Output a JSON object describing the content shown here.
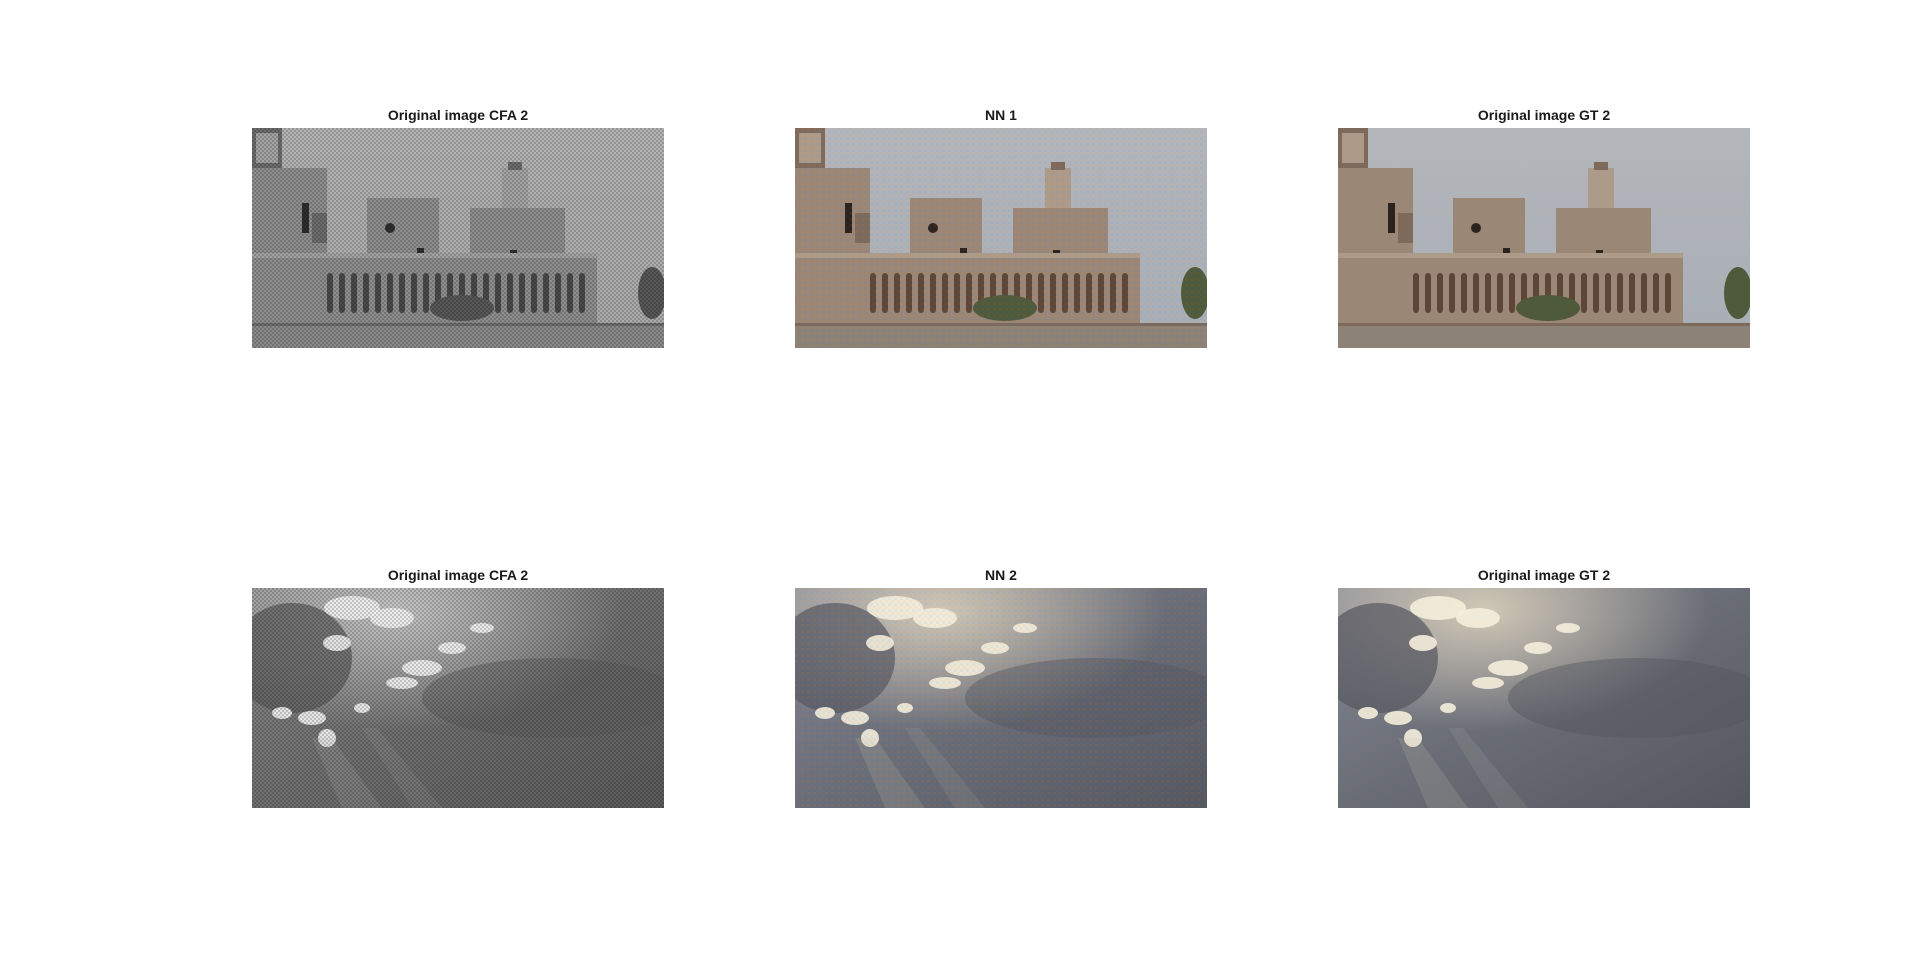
{
  "figure": {
    "panels": [
      {
        "title": "Original image CFA 2",
        "scene": "castle",
        "render": "cfa"
      },
      {
        "title": "NN 1",
        "scene": "castle",
        "render": "nn"
      },
      {
        "title": "Original image GT 2",
        "scene": "castle",
        "render": "gt"
      },
      {
        "title": "Original image CFA 2",
        "scene": "clouds",
        "render": "cfa"
      },
      {
        "title": "NN 2",
        "scene": "clouds",
        "render": "nn"
      },
      {
        "title": "Original image GT 2",
        "scene": "clouds",
        "render": "gt"
      }
    ]
  }
}
